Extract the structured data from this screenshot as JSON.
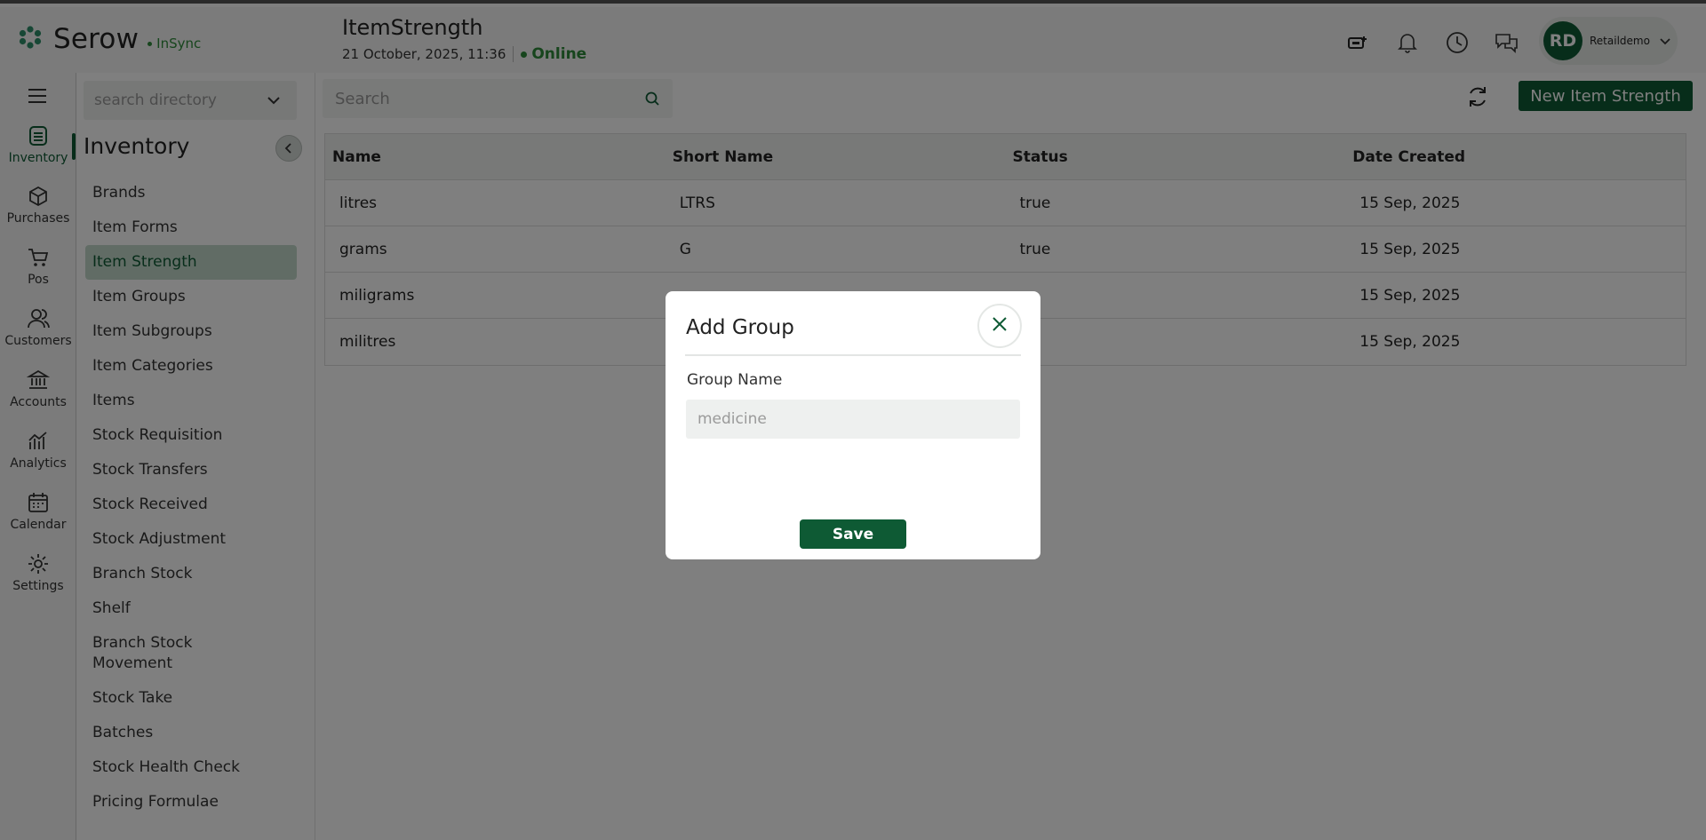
{
  "brand": {
    "name": "Serow",
    "sync_label": "InSync"
  },
  "header": {
    "title": "ItemStrength",
    "datetime": "21 October, 2025, 11:36",
    "status": "Online",
    "user": {
      "initials": "RD",
      "name": "Retaildemo"
    }
  },
  "rail": {
    "items": [
      {
        "label": "Inventory",
        "icon": "inventory-icon"
      },
      {
        "label": "Purchases",
        "icon": "purchases-icon"
      },
      {
        "label": "Pos",
        "icon": "cart-icon"
      },
      {
        "label": "Customers",
        "icon": "customers-icon"
      },
      {
        "label": "Accounts",
        "icon": "bank-icon"
      },
      {
        "label": "Analytics",
        "icon": "analytics-icon"
      },
      {
        "label": "Calendar",
        "icon": "calendar-icon"
      },
      {
        "label": "Settings",
        "icon": "gear-icon"
      }
    ]
  },
  "subnav": {
    "search_placeholder": "search directory",
    "section_title": "Inventory",
    "items": [
      "Brands",
      "Item Forms",
      "Item Strength",
      "Item Groups",
      "Item Subgroups",
      "Item Categories",
      "Items",
      "Stock Requisition",
      "Stock Transfers",
      "Stock Received",
      "Stock Adjustment",
      "Branch Stock",
      "Shelf",
      "Branch Stock Movement",
      "Stock Take",
      "Batches",
      "Stock Health Check",
      "Pricing Formulae"
    ],
    "active_item": "Item Strength"
  },
  "main": {
    "search_placeholder": "Search",
    "new_button": "New Item Strength",
    "table": {
      "columns": [
        "Name",
        "Short Name",
        "Status",
        "Date Created"
      ],
      "rows": [
        [
          "litres",
          "LTRS",
          "true",
          "15 Sep, 2025"
        ],
        [
          "grams",
          "G",
          "true",
          "15 Sep, 2025"
        ],
        [
          "miligrams",
          "",
          "",
          "15 Sep, 2025"
        ],
        [
          "militres",
          "",
          "",
          "15 Sep, 2025"
        ]
      ]
    }
  },
  "modal": {
    "title": "Add Group",
    "field_label": "Group Name",
    "field_placeholder": "medicine",
    "save_label": "Save"
  },
  "colors": {
    "primary": "#0e5a34",
    "online": "#2e8b3a"
  }
}
